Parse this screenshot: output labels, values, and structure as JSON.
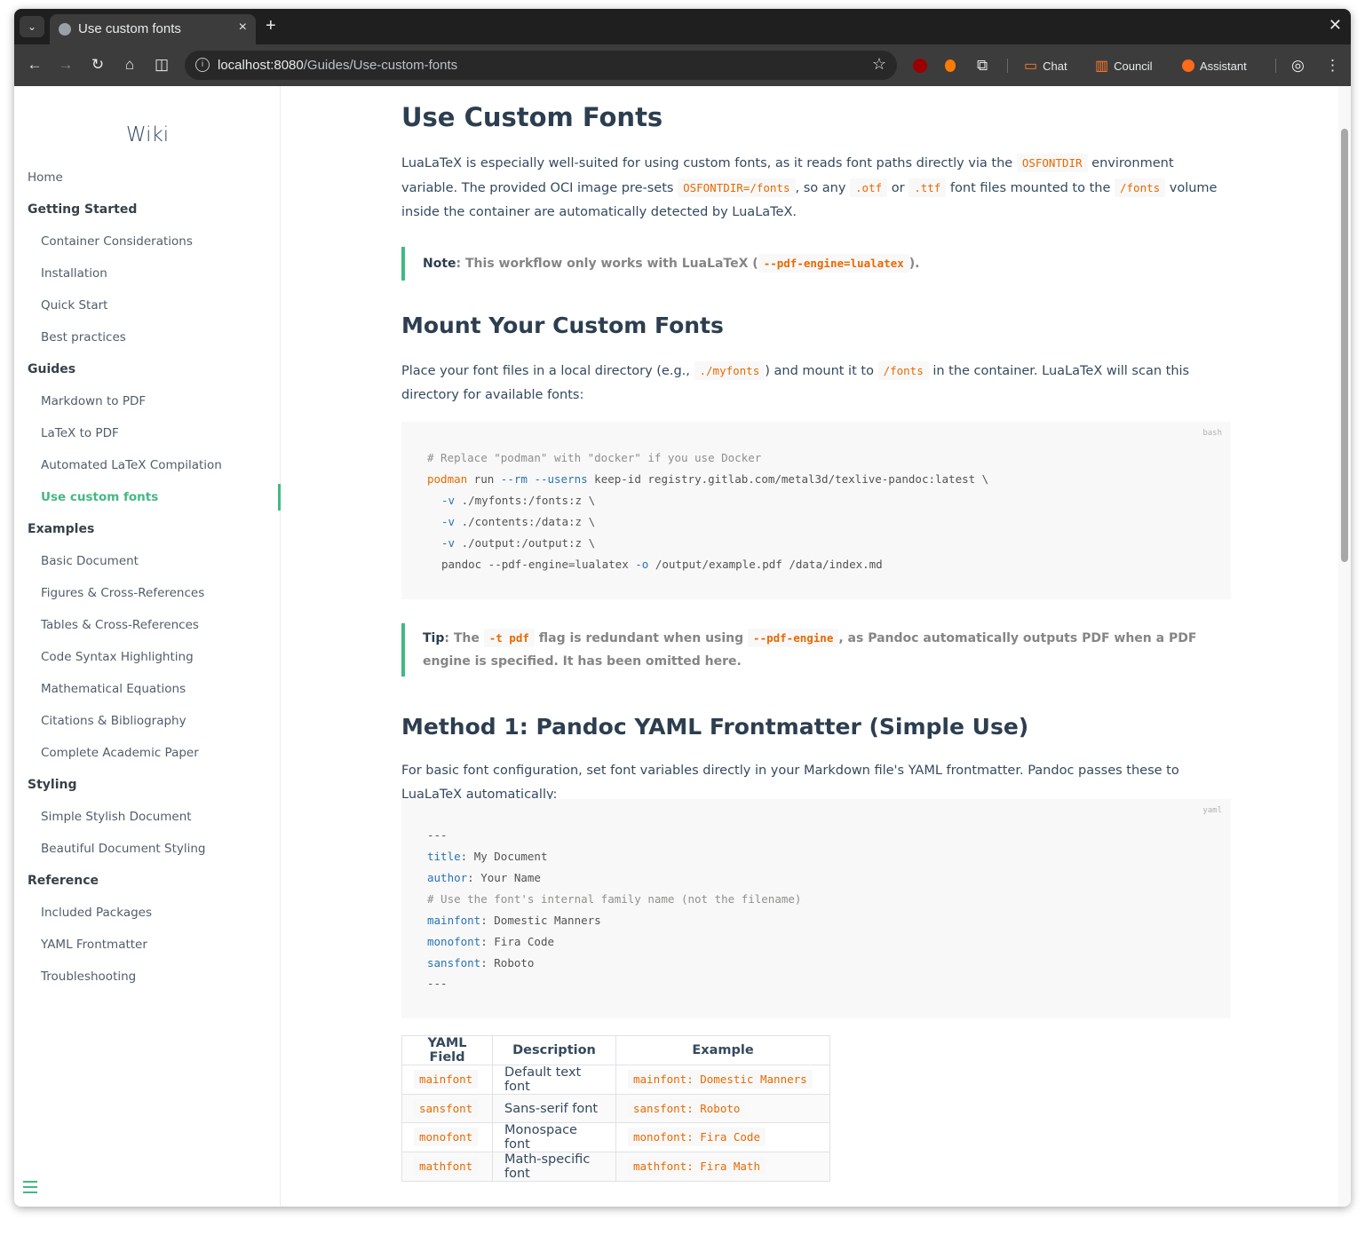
{
  "browser": {
    "tab_title": "Use custom fonts",
    "tab_close": "×",
    "new_tab": "+",
    "window_close": "✕",
    "url_host": "localhost:8080",
    "url_path": "/Guides/Use-custom-fonts",
    "extensions": [
      {
        "name": "ublock",
        "color": "#9b0000"
      },
      {
        "name": "bug",
        "color": "#ff7a00"
      }
    ],
    "actions": {
      "chat": "Chat",
      "council": "Council",
      "assistant": "Assistant"
    }
  },
  "sidebar": {
    "title": "Wiki",
    "home": "Home",
    "sections": [
      {
        "label": "Getting Started",
        "items": [
          "Container Considerations",
          "Installation",
          "Quick Start",
          "Best practices"
        ]
      },
      {
        "label": "Guides",
        "items": [
          "Markdown to PDF",
          "LaTeX to PDF",
          "Automated LaTeX Compilation",
          "Use custom fonts"
        ]
      },
      {
        "label": "Examples",
        "items": [
          "Basic Document",
          "Figures & Cross-References",
          "Tables & Cross-References",
          "Code Syntax Highlighting",
          "Mathematical Equations",
          "Citations & Bibliography",
          "Complete Academic Paper"
        ]
      },
      {
        "label": "Styling",
        "items": [
          "Simple Stylish Document",
          "Beautiful Document Styling"
        ]
      },
      {
        "label": "Reference",
        "items": [
          "Included Packages",
          "YAML Frontmatter",
          "Troubleshooting"
        ]
      }
    ],
    "active_item": "Use custom fonts",
    "accent_color": "#42b983"
  },
  "content": {
    "h1": "Use Custom Fonts",
    "intro": {
      "t1": "LuaLaTeX is especially well-suited for using custom fonts, as it reads font paths directly via the ",
      "c1": "OSFONTDIR",
      "t2": " environment variable. The provided OCI image pre-sets ",
      "c2": "OSFONTDIR=/fonts",
      "t3": ", so any ",
      "c3": ".otf",
      "t4": " or ",
      "c4": ".ttf",
      "t5": " font files mounted to the ",
      "c5": "/fonts",
      "t6": " volume inside the container are automatically detected by LuaLaTeX."
    },
    "note": {
      "label": "Note",
      "text": ": This workflow only works with LuaLaTeX (",
      "code": "--pdf-engine=lualatex",
      "end": ")."
    },
    "h2_mount": "Mount Your Custom Fonts",
    "mount_para": {
      "t1": "Place your font files in a local directory (e.g., ",
      "c1": "./myfonts",
      "t2": ") and mount it to ",
      "c2": "/fonts",
      "t3": " in the container. LuaLaTeX will scan this directory for available fonts:"
    },
    "bash_block": {
      "lang": "bash",
      "comment": "# Replace \"podman\" with \"docker\" if you use Docker",
      "l2_cmd": "podman",
      "l2_a": " run ",
      "l2_f1": "--rm",
      "l2_b": " ",
      "l2_f2": "--userns",
      "l2_c": " keep-id registry.gitlab.com/metal3d/texlive-pandoc:latest \\",
      "l3_f": "-v",
      "l3_r": " ./myfonts:/fonts:z \\",
      "l4_f": "-v",
      "l4_r": " ./contents:/data:z \\",
      "l5_f": "-v",
      "l5_r": " ./output:/output:z \\",
      "l6_a": "pandoc --pdf-engine=lualatex ",
      "l6_f": "-o",
      "l6_b": " /output/example.pdf /data/index.md"
    },
    "tip": {
      "label": "Tip",
      "t1": ": The ",
      "c1": "-t pdf",
      "t2": " flag is redundant when using ",
      "c2": "--pdf-engine",
      "t3": ", as Pandoc automatically outputs PDF when a PDF engine is specified. It has been omitted here."
    },
    "h2_method1": "Method 1: Pandoc YAML Frontmatter (Simple Use)",
    "method1_para": "For basic font configuration, set font variables directly in your Markdown file's YAML frontmatter. Pandoc passes these to LuaLaTeX automatically:",
    "yaml_block": {
      "lang": "yaml",
      "l1": "---",
      "l2_k": "title",
      "l2_v": ": My Document",
      "l3_k": "author",
      "l3_v": ": Your Name",
      "l4": "# Use the font's internal family name (not the filename)",
      "l5_k": "mainfont",
      "l5_v": ": Domestic Manners",
      "l6_k": "monofont",
      "l6_v": ": Fira Code",
      "l7_k": "sansfont",
      "l7_v": ": Roboto",
      "l8": "---"
    },
    "table": {
      "headers": [
        "YAML Field",
        "Description",
        "Example"
      ],
      "rows": [
        [
          "mainfont",
          "Default text font",
          "mainfont: Domestic Manners"
        ],
        [
          "sansfont",
          "Sans-serif font",
          "sansfont: Roboto"
        ],
        [
          "monofont",
          "Monospace font",
          "monofont: Fira Code"
        ],
        [
          "mathfont",
          "Math-specific font",
          "mathfont: Fira Math"
        ]
      ]
    }
  }
}
